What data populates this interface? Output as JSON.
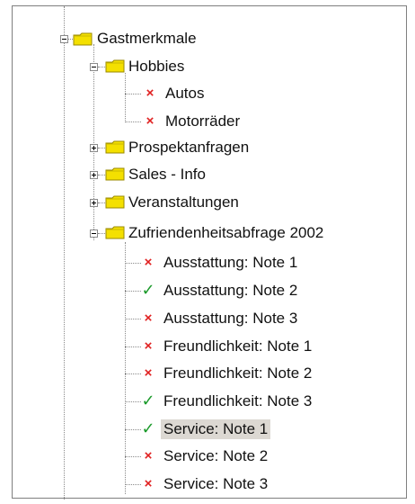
{
  "tree": {
    "root": {
      "label": "Gastmerkmale",
      "expanded": true,
      "icon": "folder-icon"
    },
    "groups": [
      {
        "label": "Hobbies",
        "expanded": true,
        "icon": "folder-icon",
        "items": [
          {
            "label": "Autos",
            "state": "unchecked",
            "mark": "×"
          },
          {
            "label": "Motorräder",
            "state": "unchecked",
            "mark": "×"
          }
        ]
      },
      {
        "label": "Prospektanfragen",
        "expanded": false,
        "icon": "folder-icon"
      },
      {
        "label": "Sales - Info",
        "expanded": false,
        "icon": "folder-icon"
      },
      {
        "label": "Veranstaltungen",
        "expanded": false,
        "icon": "folder-icon"
      },
      {
        "label": "Zufriendenheitsabfrage 2002",
        "expanded": true,
        "icon": "folder-icon",
        "items": [
          {
            "label": "Ausstattung: Note 1",
            "state": "unchecked",
            "mark": "×"
          },
          {
            "label": "Ausstattung: Note 2",
            "state": "checked",
            "mark": "✓"
          },
          {
            "label": "Ausstattung: Note 3",
            "state": "unchecked",
            "mark": "×"
          },
          {
            "label": "Freundlichkeit: Note 1",
            "state": "unchecked",
            "mark": "×"
          },
          {
            "label": "Freundlichkeit: Note 2",
            "state": "unchecked",
            "mark": "×"
          },
          {
            "label": "Freundlichkeit: Note 3",
            "state": "checked",
            "mark": "✓"
          },
          {
            "label": "Service: Note 1",
            "state": "checked",
            "mark": "✓",
            "selected": true
          },
          {
            "label": "Service: Note 2",
            "state": "unchecked",
            "mark": "×"
          },
          {
            "label": "Service: Note 3",
            "state": "unchecked",
            "mark": "×"
          }
        ]
      }
    ]
  },
  "colors": {
    "folder_fill": "#f4e000",
    "folder_outline": "#9a8a00",
    "cross": "#e02020",
    "check": "#1a9a2a",
    "selection": "#dcd8d2"
  }
}
